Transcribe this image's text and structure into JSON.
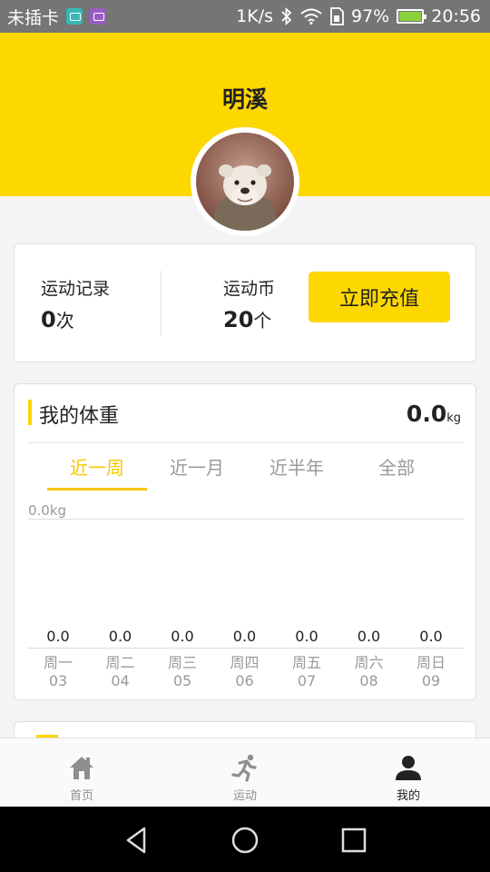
{
  "status_bar": {
    "carrier": "未插卡",
    "net_speed": "1K/s",
    "battery_percent": "97%",
    "time": "20:56",
    "battery_level": 0.97
  },
  "profile": {
    "name": "明溪"
  },
  "stats": {
    "record_label": "运动记录",
    "record_value": "0",
    "record_unit": "次",
    "coins_label": "运动币",
    "coins_value": "20",
    "coins_unit": "个",
    "recharge_label": "立即充值"
  },
  "weight": {
    "title": "我的体重",
    "value": "0.0",
    "unit": "kg",
    "tabs": [
      "近一周",
      "近一月",
      "近半年",
      "全部"
    ],
    "active_tab": 0,
    "y_label": "0.0kg",
    "points": [
      {
        "value": "0.0",
        "day": "周一",
        "date": "03"
      },
      {
        "value": "0.0",
        "day": "周二",
        "date": "04"
      },
      {
        "value": "0.0",
        "day": "周三",
        "date": "05"
      },
      {
        "value": "0.0",
        "day": "周四",
        "date": "06"
      },
      {
        "value": "0.0",
        "day": "周五",
        "date": "07"
      },
      {
        "value": "0.0",
        "day": "周六",
        "date": "08"
      },
      {
        "value": "0.0",
        "day": "周日",
        "date": "09"
      }
    ]
  },
  "bottom_nav": {
    "items": [
      {
        "label": "首页",
        "icon": "home-icon"
      },
      {
        "label": "运动",
        "icon": "running-icon"
      },
      {
        "label": "我的",
        "icon": "person-icon"
      }
    ],
    "active": 2
  },
  "colors": {
    "accent": "#fdd700",
    "status_bar": "#757575",
    "text_muted": "#9a9a9a"
  }
}
